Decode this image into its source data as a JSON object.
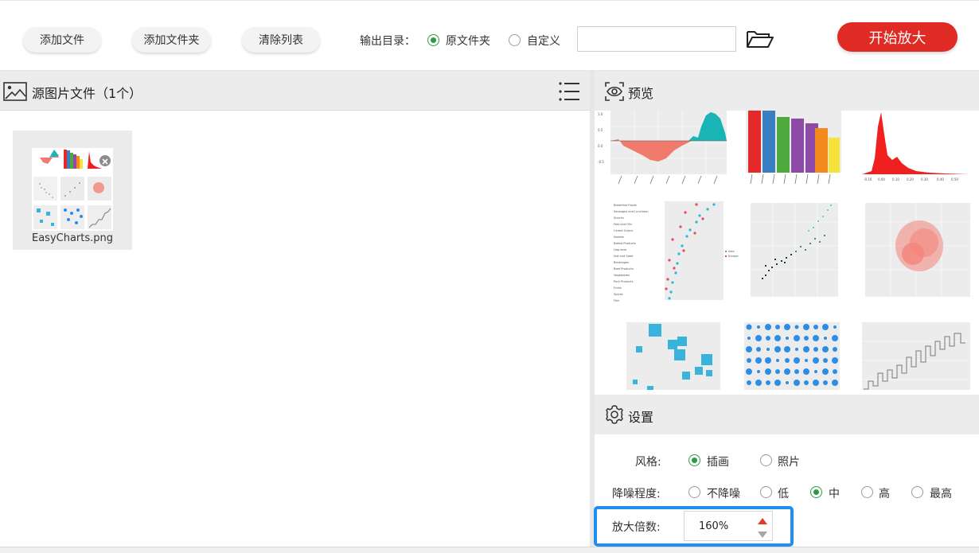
{
  "toolbar": {
    "add_file": "添加文件",
    "add_folder": "添加文件夹",
    "clear_list": "清除列表",
    "output_dir_label": "输出目录：",
    "opt_source_folder": "原文件夹",
    "opt_custom": "自定义",
    "output_path_value": "",
    "start_button": "开始放大"
  },
  "left_panel": {
    "title": "源图片文件（1个）",
    "files": [
      {
        "name": "EasyCharts.png"
      }
    ]
  },
  "preview": {
    "title": "预览"
  },
  "settings": {
    "title": "设置",
    "style_label": "风格:",
    "style_options": [
      "插画",
      "照片"
    ],
    "style_selected": "插画",
    "denoise_label": "降噪程度:",
    "denoise_options": [
      "不降噪",
      "低",
      "中",
      "高",
      "最高"
    ],
    "denoise_selected": "中",
    "scale_label": "放大倍数:",
    "scale_value": "160%"
  },
  "colors": {
    "accent_green": "#2d9a44",
    "start_red": "#e02a24",
    "highlight_blue": "#1e8fee",
    "spinner_up": "#e53a2f"
  }
}
